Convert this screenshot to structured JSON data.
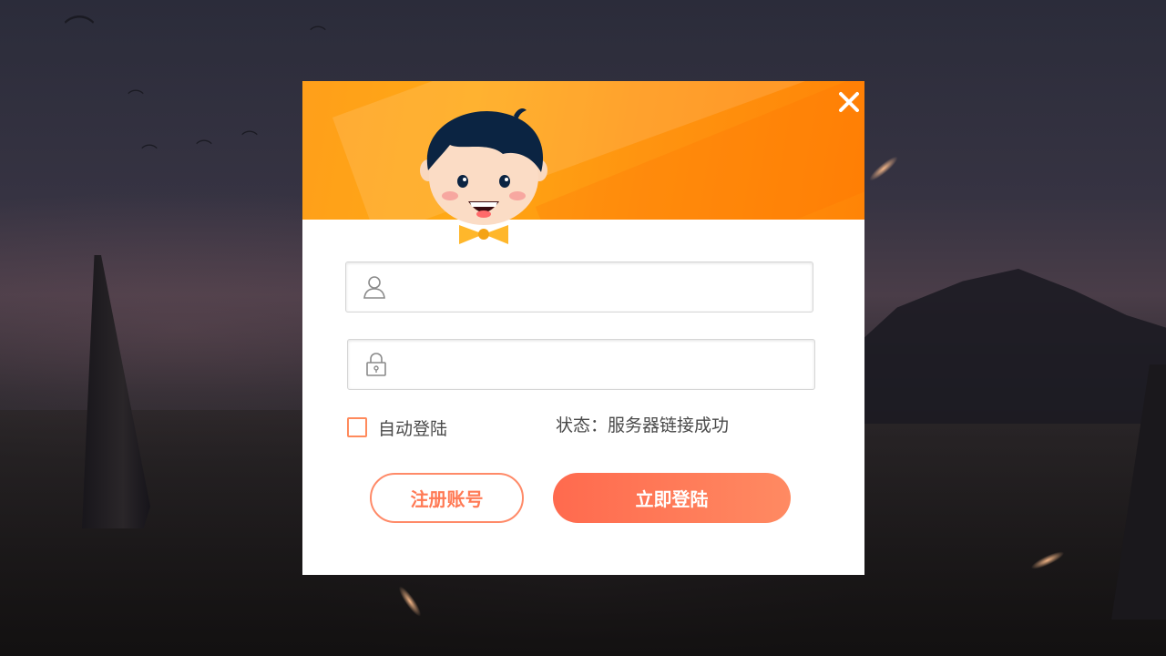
{
  "dialog": {
    "close_icon": "close-icon",
    "avatar_icon": "boy-avatar-icon"
  },
  "username": {
    "icon": "user-icon",
    "value": "",
    "placeholder": ""
  },
  "password": {
    "icon": "lock-icon",
    "value": "",
    "placeholder": ""
  },
  "remember": {
    "label": "自动登陆",
    "checked": false
  },
  "status": {
    "text": "状态：服务器链接成功"
  },
  "actions": {
    "register_label": "注册账号",
    "login_label": "立即登陆"
  },
  "colors": {
    "header_orange": "#ff9a12",
    "accent": "#ff7a55",
    "login_gradient_start": "#ff6a4e",
    "login_gradient_end": "#ff8a62"
  }
}
